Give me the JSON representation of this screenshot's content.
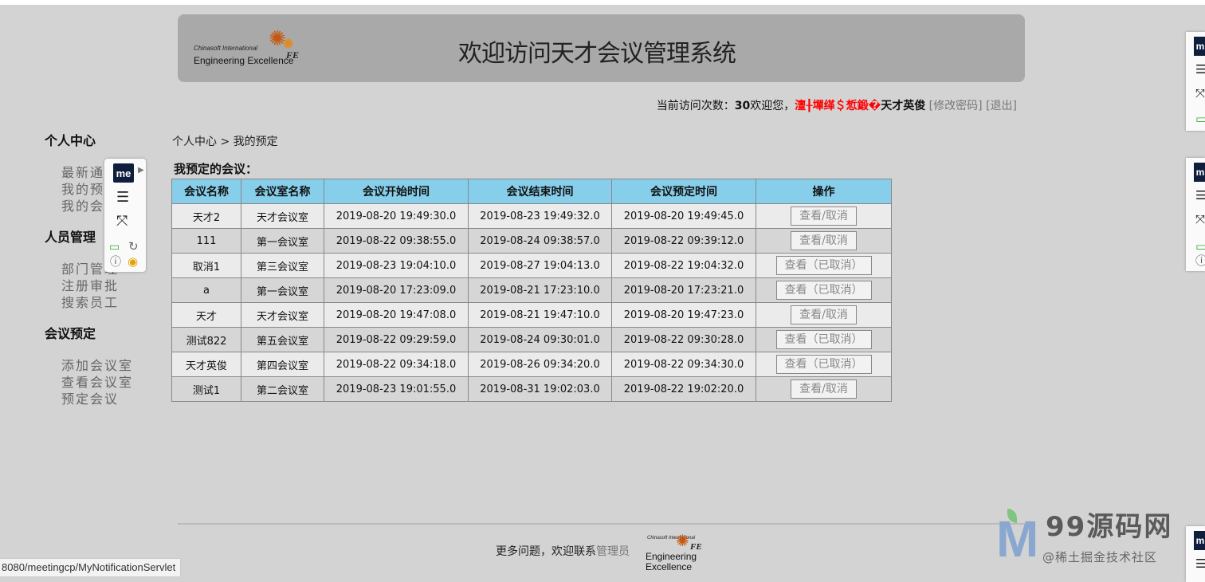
{
  "header": {
    "logo_small": "Chinasoft International",
    "logo_big": "Engineering Excellence",
    "logo_mark": "FE",
    "title": "欢迎访问天才会议管理系统"
  },
  "visit": {
    "label": "当前访问次数：",
    "count": "30",
    "welcome": "欢迎您，",
    "garbled": "澶╂墠缂＄惁鍛�",
    "username": "天才英俊",
    "change_password": "[修改密码]",
    "logout": "[退出]"
  },
  "sidebar": {
    "groups": [
      {
        "title": "个人中心",
        "items": [
          "最新通知",
          "我的预定",
          "我的会议"
        ]
      },
      {
        "title": "人员管理",
        "items": [
          "部门管理",
          "注册审批",
          "搜索员工"
        ]
      },
      {
        "title": "会议预定",
        "items": [
          "添加会议室",
          "查看会议室",
          "预定会议"
        ]
      }
    ]
  },
  "extension_popup": {
    "badge": "me"
  },
  "breadcrumb": "个人中心 > 我的预定",
  "section_title": "我预定的会议：",
  "table": {
    "headers": [
      "会议名称",
      "会议室名称",
      "会议开始时间",
      "会议结束时间",
      "会议预定时间",
      "操作"
    ],
    "rows": [
      {
        "name": "天才2",
        "room": "天才会议室",
        "start": "2019-08-20 19:49:30.0",
        "end": "2019-08-23 19:49:32.0",
        "booked": "2019-08-20 19:49:45.0",
        "action": "查看/取消"
      },
      {
        "name": "111",
        "room": "第一会议室",
        "start": "2019-08-22 09:38:55.0",
        "end": "2019-08-24 09:38:57.0",
        "booked": "2019-08-22 09:39:12.0",
        "action": "查看/取消"
      },
      {
        "name": "取消1",
        "room": "第三会议室",
        "start": "2019-08-23 19:04:10.0",
        "end": "2019-08-27 19:04:13.0",
        "booked": "2019-08-22 19:04:32.0",
        "action": "查看（已取消）"
      },
      {
        "name": "a",
        "room": "第一会议室",
        "start": "2019-08-20 17:23:09.0",
        "end": "2019-08-21 17:23:10.0",
        "booked": "2019-08-20 17:23:21.0",
        "action": "查看（已取消）"
      },
      {
        "name": "天才",
        "room": "天才会议室",
        "start": "2019-08-20 19:47:08.0",
        "end": "2019-08-21 19:47:10.0",
        "booked": "2019-08-20 19:47:23.0",
        "action": "查看/取消"
      },
      {
        "name": "测试822",
        "room": "第五会议室",
        "start": "2019-08-22 09:29:59.0",
        "end": "2019-08-24 09:30:01.0",
        "booked": "2019-08-22 09:30:28.0",
        "action": "查看（已取消）"
      },
      {
        "name": "天才英俊",
        "room": "第四会议室",
        "start": "2019-08-22 09:34:18.0",
        "end": "2019-08-26 09:34:20.0",
        "booked": "2019-08-22 09:34:30.0",
        "action": "查看（已取消）"
      },
      {
        "name": "测试1",
        "room": "第二会议室",
        "start": "2019-08-23 19:01:55.0",
        "end": "2019-08-31 19:02:03.0",
        "booked": "2019-08-22 19:02:20.0",
        "action": "查看/取消"
      }
    ]
  },
  "footer": {
    "text": "更多问题，欢迎联系",
    "admin_link": "管理员",
    "logo_small": "Chinasoft International",
    "logo_big": "Engineering Excellence",
    "logo_mark": "FE"
  },
  "status_url": "8080/meetingcp/MyNotificationServlet",
  "watermark": {
    "brand": "99源码网",
    "sub": "@稀土掘金技术社区"
  },
  "right_extension": {
    "badge": "m"
  },
  "colors": {
    "background": "#d3d3d3",
    "header_bg": "#a9a9a9",
    "table_header": "#87ceeb",
    "garbled_text": "#ff0000"
  }
}
